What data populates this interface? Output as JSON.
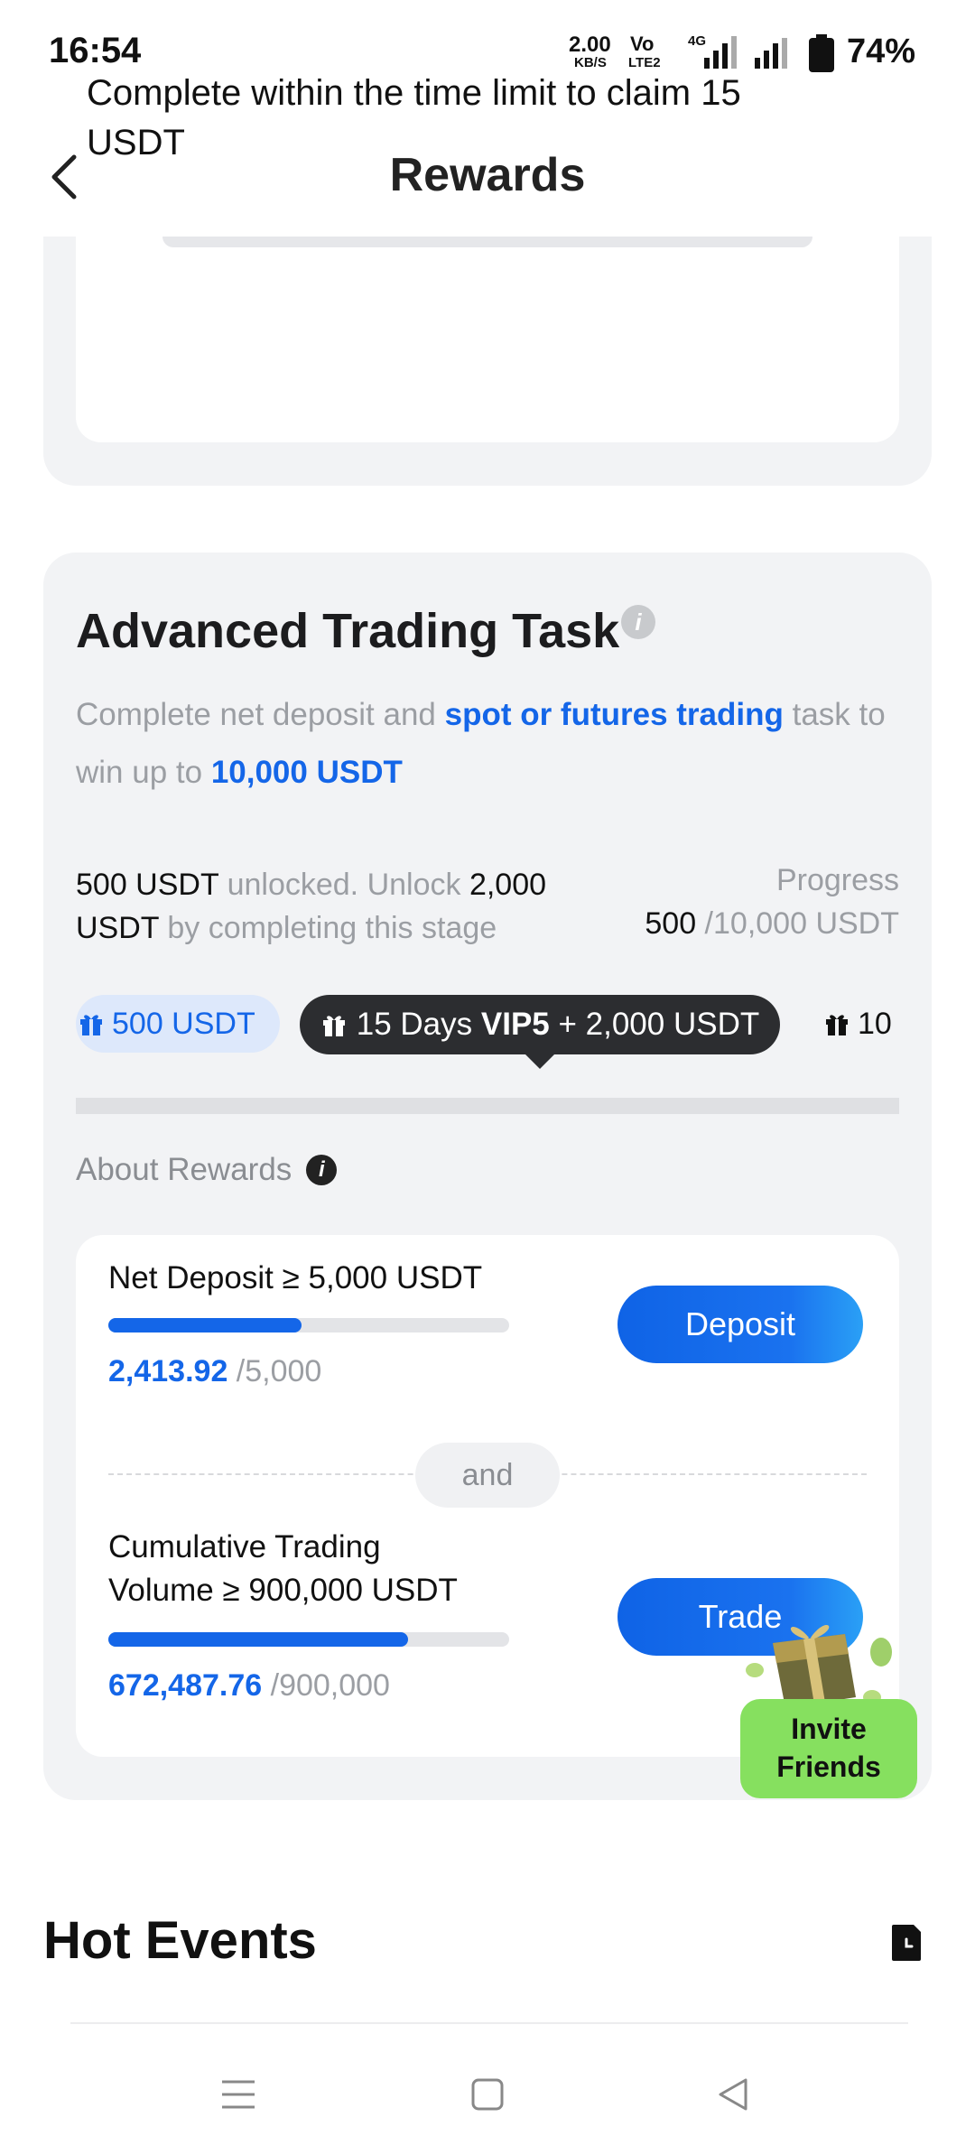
{
  "status_bar": {
    "time": "16:54",
    "net_speed_value": "2.00",
    "net_speed_unit": "KB/S",
    "volte_top": "Vo",
    "volte_bottom": "LTE2",
    "network_type": "4G",
    "battery_percent": "74%"
  },
  "header": {
    "title": "Rewards"
  },
  "top_card": {
    "claim_text": "Complete within the time limit to claim 15 USDT"
  },
  "advanced_task": {
    "title": "Advanced Trading Task",
    "description_prefix": "Complete net deposit and ",
    "description_highlight": "spot or futures trading",
    "description_middle": " task to win up to ",
    "description_amount": "10,000 USDT",
    "unlocked_amount": "500 USDT",
    "unlocked_text": " unlocked. Unlock ",
    "unlock_target_number": "2,000",
    "unlock_target_unit": "USDT",
    "unlock_suffix": " by completing this stage",
    "progress_label": "Progress",
    "progress_current": "500",
    "progress_total": " /10,000 USDT",
    "milestones": {
      "first": "500 USDT",
      "current_prefix": "15 Days ",
      "current_vip": "VIP5",
      "current_suffix": " + 2,000 USDT",
      "next": "10"
    },
    "about_rewards": "About Rewards"
  },
  "tasks": {
    "deposit": {
      "label": "Net Deposit ≥ 5,000 USDT",
      "current": "2,413.92",
      "target": " /5,000",
      "progress_fraction": 0.4828,
      "button": "Deposit"
    },
    "connector": "and",
    "trading": {
      "label_line1": "Cumulative Trading",
      "label_line2": "Volume ≥ 900,000 USDT",
      "current": "672,487.76",
      "target": " /900,000",
      "progress_fraction": 0.7472,
      "button": "Trade"
    }
  },
  "invite": {
    "line1": "Invite",
    "line2": "Friends"
  },
  "hot_events": {
    "title": "Hot Events"
  },
  "colors": {
    "accent_blue": "#1466e8",
    "invite_green": "#86e05f",
    "card_bg": "#f2f3f5",
    "dark_chip": "#2c2d30"
  }
}
